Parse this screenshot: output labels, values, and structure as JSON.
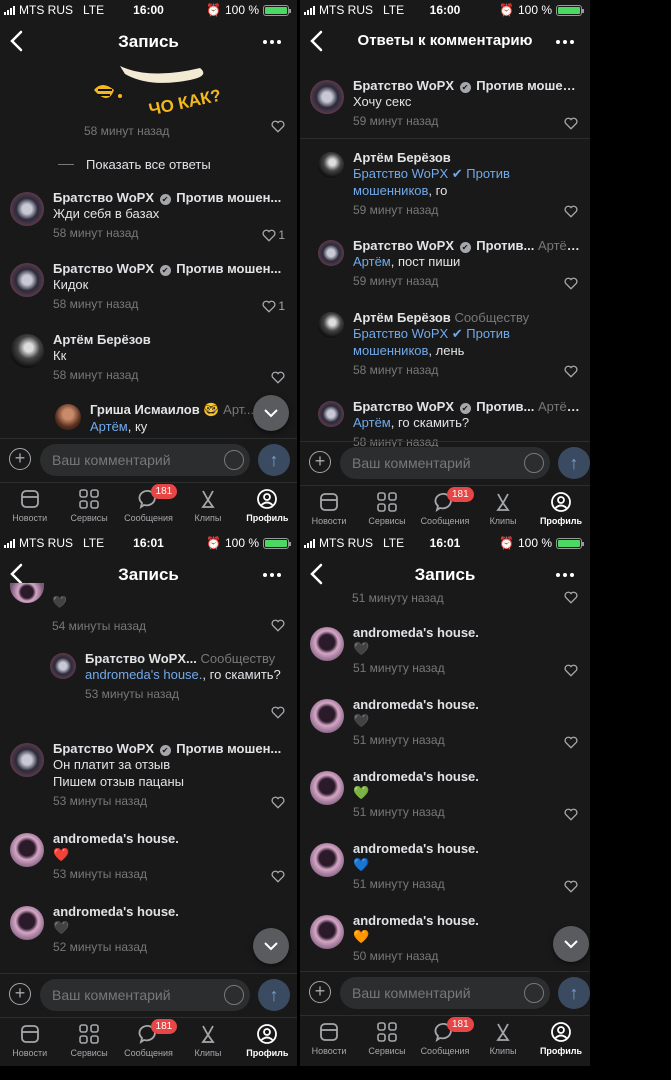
{
  "status": {
    "carrier": "MTS RUS",
    "network": "LTE",
    "battery": "100 %",
    "battery_level": 100
  },
  "panels": [
    {
      "time": "16:00",
      "title": "Запись"
    },
    {
      "time": "16:00",
      "title": "Ответы к комментарию"
    },
    {
      "time": "16:01",
      "title": "Запись"
    },
    {
      "time": "16:01",
      "title": "Запись"
    }
  ],
  "p1": {
    "sticker_text": "ЧО КАК?",
    "first_time": "58 минут назад",
    "show_all": "Показать все ответы",
    "comments": [
      {
        "name": "Братство WoPX",
        "name_rest": "Против мошен...",
        "text": "Жди себя в базах",
        "time": "58 минут назад",
        "likes": "1"
      },
      {
        "name": "Братство WoPX",
        "name_rest": "Против мошен...",
        "text": "Кидок",
        "time": "58 минут назад",
        "likes": "1"
      },
      {
        "name": "Артём Берёзов",
        "text": "Кк",
        "time": "58 минут назад"
      }
    ],
    "reply": {
      "name": "Гриша Исмаилов 🤓",
      "suffix": "Арт...",
      "mention": "Артём",
      "text": ", ку"
    }
  },
  "p2": {
    "comments": [
      {
        "name": "Братство WoPX",
        "name_rest": "Против мошен...",
        "text": "Хочу секс",
        "time": "59 минут назад"
      },
      {
        "name": "Артём Берёзов",
        "mention": "Братство WoPX ✔ Против мошенников",
        "text": ", го",
        "time": "59 минут назад"
      },
      {
        "name": "Братство WoPX",
        "name_rest": "Против...",
        "suffix": "Артёму",
        "mention": "Артём",
        "text": ", пост пиши",
        "time": "59 минут назад"
      },
      {
        "name": "Артём Берёзов",
        "suffix": "Сообществу",
        "mention": "Братство WoPX ✔ Против мошенников",
        "text": ", лень",
        "time": "58 минут назад"
      },
      {
        "name": "Братство WoPX",
        "name_rest": "Против...",
        "suffix": "Артёму",
        "mention": "Артём",
        "text": ",   го скамить?",
        "time": "58 минут назад"
      }
    ]
  },
  "p3": {
    "top_emoji": "🖤",
    "top_time": "54 минуты назад",
    "reply": {
      "name": "Братство WoPX...",
      "suffix": "Сообществу",
      "mention": "andromeda's house.",
      "text": ", го скамить?",
      "time": "53 минуты назад"
    },
    "comments": [
      {
        "name": "Братство WoPX",
        "name_rest": "Против мошен...",
        "text": "Он платит за отзыв",
        "text2": "Пишем отзыв пацаны",
        "time": "53 минуты назад"
      },
      {
        "name": "andromeda's house.",
        "text": "❤️",
        "time": "53 минуты назад"
      },
      {
        "name": "andromeda's house.",
        "text": "🖤",
        "time": "52 минуты назад"
      }
    ]
  },
  "p4": {
    "top_time": "51 минуту назад",
    "comments": [
      {
        "name": "andromeda's house.",
        "text": "🖤",
        "time": "51 минуту назад"
      },
      {
        "name": "andromeda's house.",
        "text": "🖤",
        "time": "51 минуту назад"
      },
      {
        "name": "andromeda's house.",
        "text": "💚",
        "time": "51 минуту назад"
      },
      {
        "name": "andromeda's house.",
        "text": "💙",
        "time": "51 минуту назад"
      },
      {
        "name": "andromeda's house.",
        "text": "🧡",
        "time": "50 минут назад"
      }
    ]
  },
  "input": {
    "placeholder": "Ваш комментарий"
  },
  "tabs": [
    {
      "label": "Новости",
      "icon": "news-icon"
    },
    {
      "label": "Сервисы",
      "icon": "services-icon"
    },
    {
      "label": "Сообщения",
      "icon": "messages-icon",
      "counter": "181"
    },
    {
      "label": "Клипы",
      "icon": "clips-icon"
    },
    {
      "label": "Профиль",
      "icon": "profile-icon",
      "active": true
    }
  ],
  "colors": {
    "background": "#19191a",
    "accent": "#71aaeb",
    "badge": "#e64646",
    "battery": "#4bd963"
  }
}
